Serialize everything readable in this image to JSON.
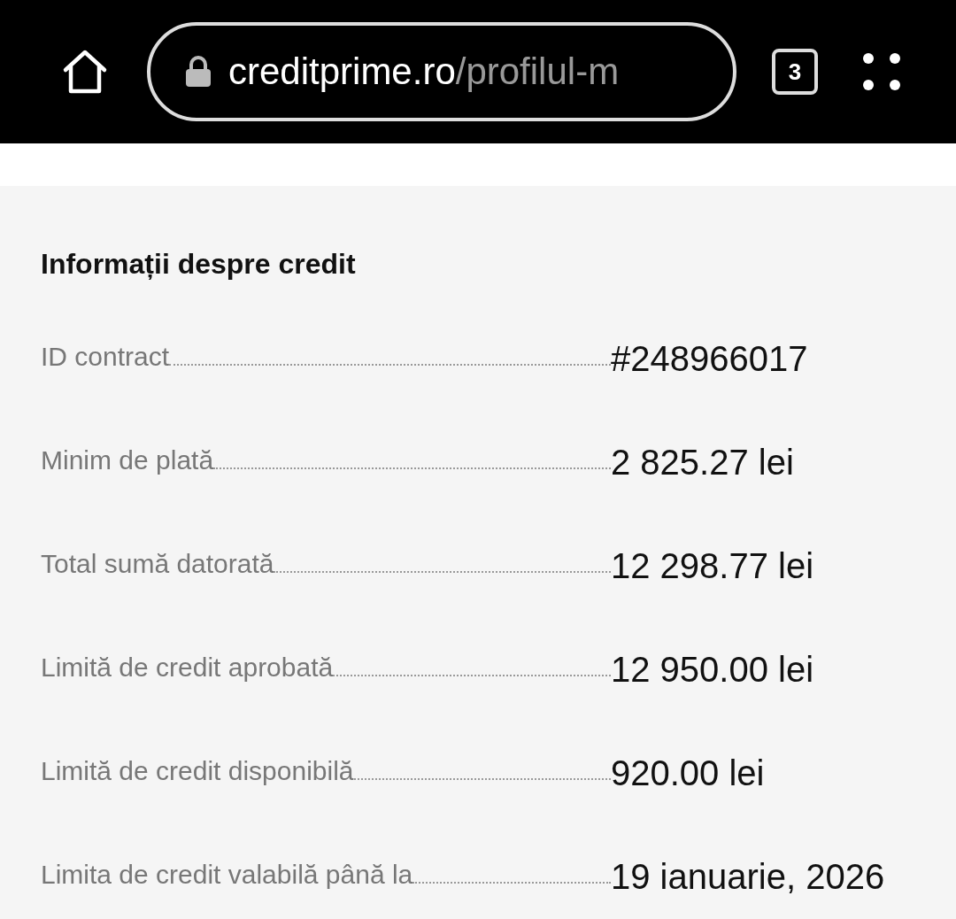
{
  "browser_bar": {
    "url_domain": "creditprime.ro",
    "url_path": "/profilul-m",
    "tab_count": "3"
  },
  "section": {
    "title": "Informații despre credit",
    "rows": [
      {
        "label": "ID contract",
        "value": "#248966017"
      },
      {
        "label": "Minim de plată",
        "value": "2 825.27 lei"
      },
      {
        "label": "Total sumă datorată",
        "value": "12 298.77 lei"
      },
      {
        "label": "Limită de credit aprobată",
        "value": "12 950.00 lei"
      },
      {
        "label": "Limită de credit disponibilă",
        "value": "920.00 lei"
      },
      {
        "label": "Limita de credit valabilă până la",
        "value": "19 ianuarie, 2026"
      }
    ]
  }
}
